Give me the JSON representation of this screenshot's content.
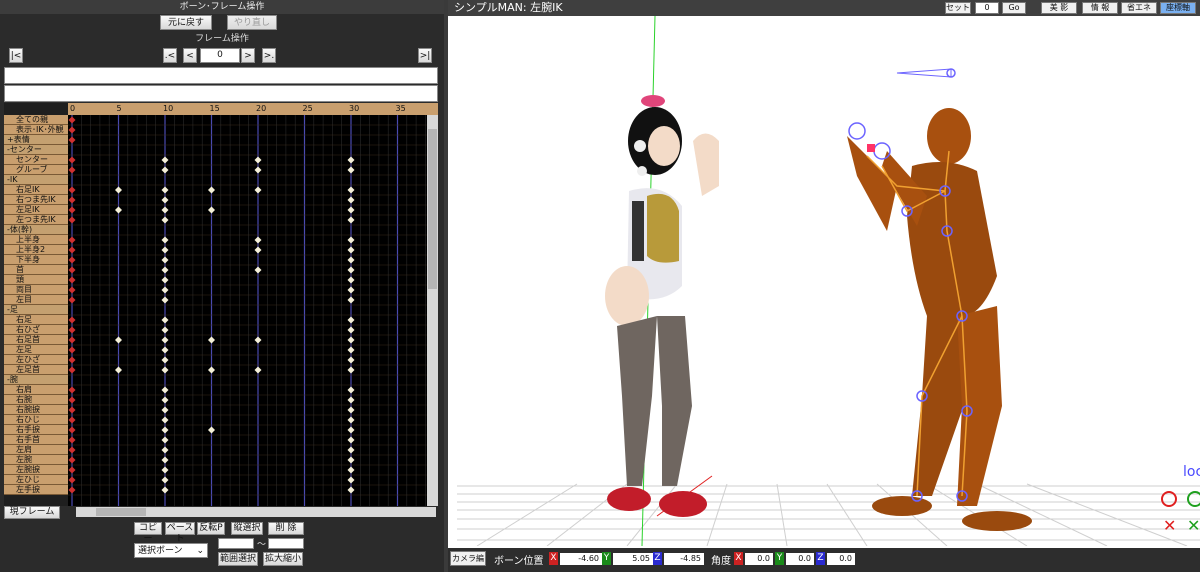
{
  "left_panel": {
    "title": "ボーン･フレーム操作",
    "undo_label": "元に戻す",
    "redo_label": "やり直し",
    "frame_ops_title": "フレーム操作",
    "nav": {
      "first": "|<",
      "prev_key": ".<",
      "prev": "<",
      "frame_value": "0",
      "next": ">",
      "next_key": ">.",
      "last": ">|"
    },
    "ruler_ticks": [
      "0",
      "5",
      "10",
      "15",
      "20",
      "25",
      "30",
      "35"
    ],
    "rows": [
      {
        "label": "全ての親",
        "type": "child",
        "keys": [
          0
        ]
      },
      {
        "label": "表示･IK･外観",
        "type": "child",
        "keys": [
          0
        ]
      },
      {
        "label": "+表情",
        "type": "group",
        "keys": [
          0
        ]
      },
      {
        "label": "-センター",
        "type": "group",
        "keys": []
      },
      {
        "label": "センター",
        "type": "child",
        "keys": [
          0,
          10,
          20,
          30
        ]
      },
      {
        "label": "グルーブ",
        "type": "child",
        "keys": [
          0,
          10,
          20,
          30
        ]
      },
      {
        "label": "-IK",
        "type": "group",
        "keys": []
      },
      {
        "label": "右足IK",
        "type": "child",
        "keys": [
          0,
          5,
          10,
          15,
          20,
          30
        ]
      },
      {
        "label": "右つま先IK",
        "type": "child",
        "keys": [
          0,
          10,
          30
        ]
      },
      {
        "label": "左足IK",
        "type": "child",
        "keys": [
          0,
          5,
          10,
          15,
          30
        ]
      },
      {
        "label": "左つま先IK",
        "type": "child",
        "keys": [
          0,
          10,
          30
        ]
      },
      {
        "label": "-体(幹)",
        "type": "group",
        "keys": []
      },
      {
        "label": "上半身",
        "type": "child",
        "keys": [
          0,
          10,
          20,
          30
        ]
      },
      {
        "label": "上半身2",
        "type": "child",
        "keys": [
          0,
          10,
          20,
          30
        ]
      },
      {
        "label": "下半身",
        "type": "child",
        "keys": [
          0,
          10,
          30
        ]
      },
      {
        "label": "首",
        "type": "child",
        "keys": [
          0,
          10,
          20,
          30
        ]
      },
      {
        "label": "頭",
        "type": "child",
        "keys": [
          0,
          10,
          30
        ]
      },
      {
        "label": "両目",
        "type": "child",
        "keys": [
          0,
          10,
          30
        ]
      },
      {
        "label": "左目",
        "type": "child",
        "keys": [
          0,
          10,
          30
        ]
      },
      {
        "label": "-足",
        "type": "group",
        "keys": []
      },
      {
        "label": "右足",
        "type": "child",
        "keys": [
          0,
          10,
          30
        ]
      },
      {
        "label": "右ひざ",
        "type": "child",
        "keys": [
          0,
          10,
          30
        ]
      },
      {
        "label": "右足首",
        "type": "child",
        "keys": [
          0,
          5,
          10,
          15,
          20,
          30
        ]
      },
      {
        "label": "左足",
        "type": "child",
        "keys": [
          0,
          10,
          30
        ]
      },
      {
        "label": "左ひざ",
        "type": "child",
        "keys": [
          0,
          10,
          30
        ]
      },
      {
        "label": "左足首",
        "type": "child",
        "keys": [
          0,
          5,
          10,
          15,
          20,
          30
        ]
      },
      {
        "label": "-腕",
        "type": "group",
        "keys": []
      },
      {
        "label": "右肩",
        "type": "child",
        "keys": [
          0,
          10,
          30
        ]
      },
      {
        "label": "右腕",
        "type": "child",
        "keys": [
          0,
          10,
          30
        ]
      },
      {
        "label": "右腕捩",
        "type": "child",
        "keys": [
          0,
          10,
          30
        ]
      },
      {
        "label": "右ひじ",
        "type": "child",
        "keys": [
          0,
          10,
          30
        ]
      },
      {
        "label": "右手捩",
        "type": "child",
        "keys": [
          0,
          10,
          15,
          30
        ]
      },
      {
        "label": "右手首",
        "type": "child",
        "keys": [
          0,
          10,
          30
        ]
      },
      {
        "label": "左肩",
        "type": "child",
        "keys": [
          0,
          10,
          30
        ]
      },
      {
        "label": "左腕",
        "type": "child",
        "keys": [
          0,
          10,
          30
        ]
      },
      {
        "label": "左腕捩",
        "type": "child",
        "keys": [
          0,
          10,
          30
        ]
      },
      {
        "label": "左ひじ",
        "type": "child",
        "keys": [
          0,
          10,
          30
        ]
      },
      {
        "label": "左手捩",
        "type": "child",
        "keys": [
          0,
          10,
          30
        ]
      }
    ],
    "current_frame_label": "現フレーム",
    "copy_label": "コピー",
    "paste_label": "ペースト",
    "flip_paste_label": "反転P",
    "vertical_select_label": "縦選択",
    "delete_label": "削 除",
    "select_bone": "選択ボーン",
    "range_tilde": "～",
    "range_select_label": "範囲選択",
    "zoom_label": "拡大縮小"
  },
  "right_panel": {
    "title": "シンプルMAN: 左腕IK",
    "set_label": "セット",
    "frame_input": "0",
    "go_label": "Go",
    "shadow_label": "美 影",
    "info_label": "情 報",
    "eco_label": "省エネ",
    "coord_label": "座標軸",
    "side_text": "loc",
    "camera_button": "カメラ編",
    "bone_pos_label": "ボーン位置",
    "pos": {
      "x": "-4.60",
      "y": "5.05",
      "z": "-4.85"
    },
    "angle_label": "角度",
    "rot": {
      "x": "0.0",
      "y": "0.0",
      "z": "0.0"
    },
    "axis_x": "X",
    "axis_y": "Y",
    "axis_z": "Z"
  },
  "colors": {
    "key_white": "#f5f0d8",
    "key_red": "#d03030",
    "ruler": "#c99f6e",
    "active_tab": "#7ab0f0"
  }
}
